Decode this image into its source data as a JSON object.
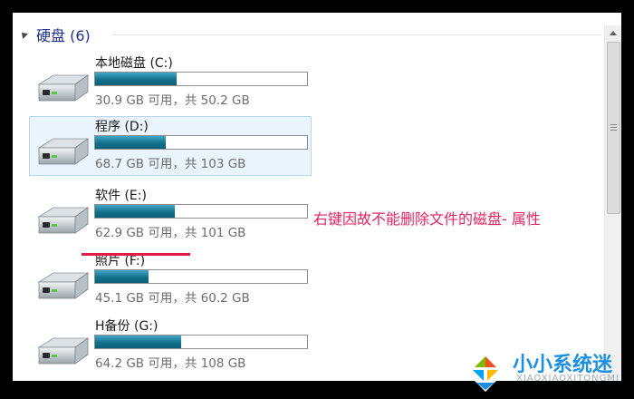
{
  "group": {
    "title": "硬盘 (6)"
  },
  "drives": [
    {
      "name": "本地磁盘 (C:)",
      "capacity": "30.9 GB 可用，共 50.2 GB",
      "used_fraction": 0.385,
      "selected": false
    },
    {
      "name": "程序 (D:)",
      "capacity": "68.7 GB 可用，共 103 GB",
      "used_fraction": 0.333,
      "selected": true
    },
    {
      "name": "软件 (E:)",
      "capacity": "62.9 GB 可用，共 101 GB",
      "used_fraction": 0.377,
      "selected": false
    },
    {
      "name": "照片 (F:)",
      "capacity": "45.1 GB 可用，共 60.2 GB",
      "used_fraction": 0.251,
      "selected": false
    },
    {
      "name": "H备份 (G:)",
      "capacity": "64.2 GB 可用，共 108 GB",
      "used_fraction": 0.406,
      "selected": false
    }
  ],
  "annotation": "右键因故不能删除文件的磁盘- 属性",
  "watermark": {
    "text": "小小系统迷",
    "sub": "XIAOXIAOXITONGMI"
  },
  "colors": {
    "bar_fill": "#1b7e9c",
    "annotation": "#e0245e",
    "watermark": "#1b8fe0"
  }
}
